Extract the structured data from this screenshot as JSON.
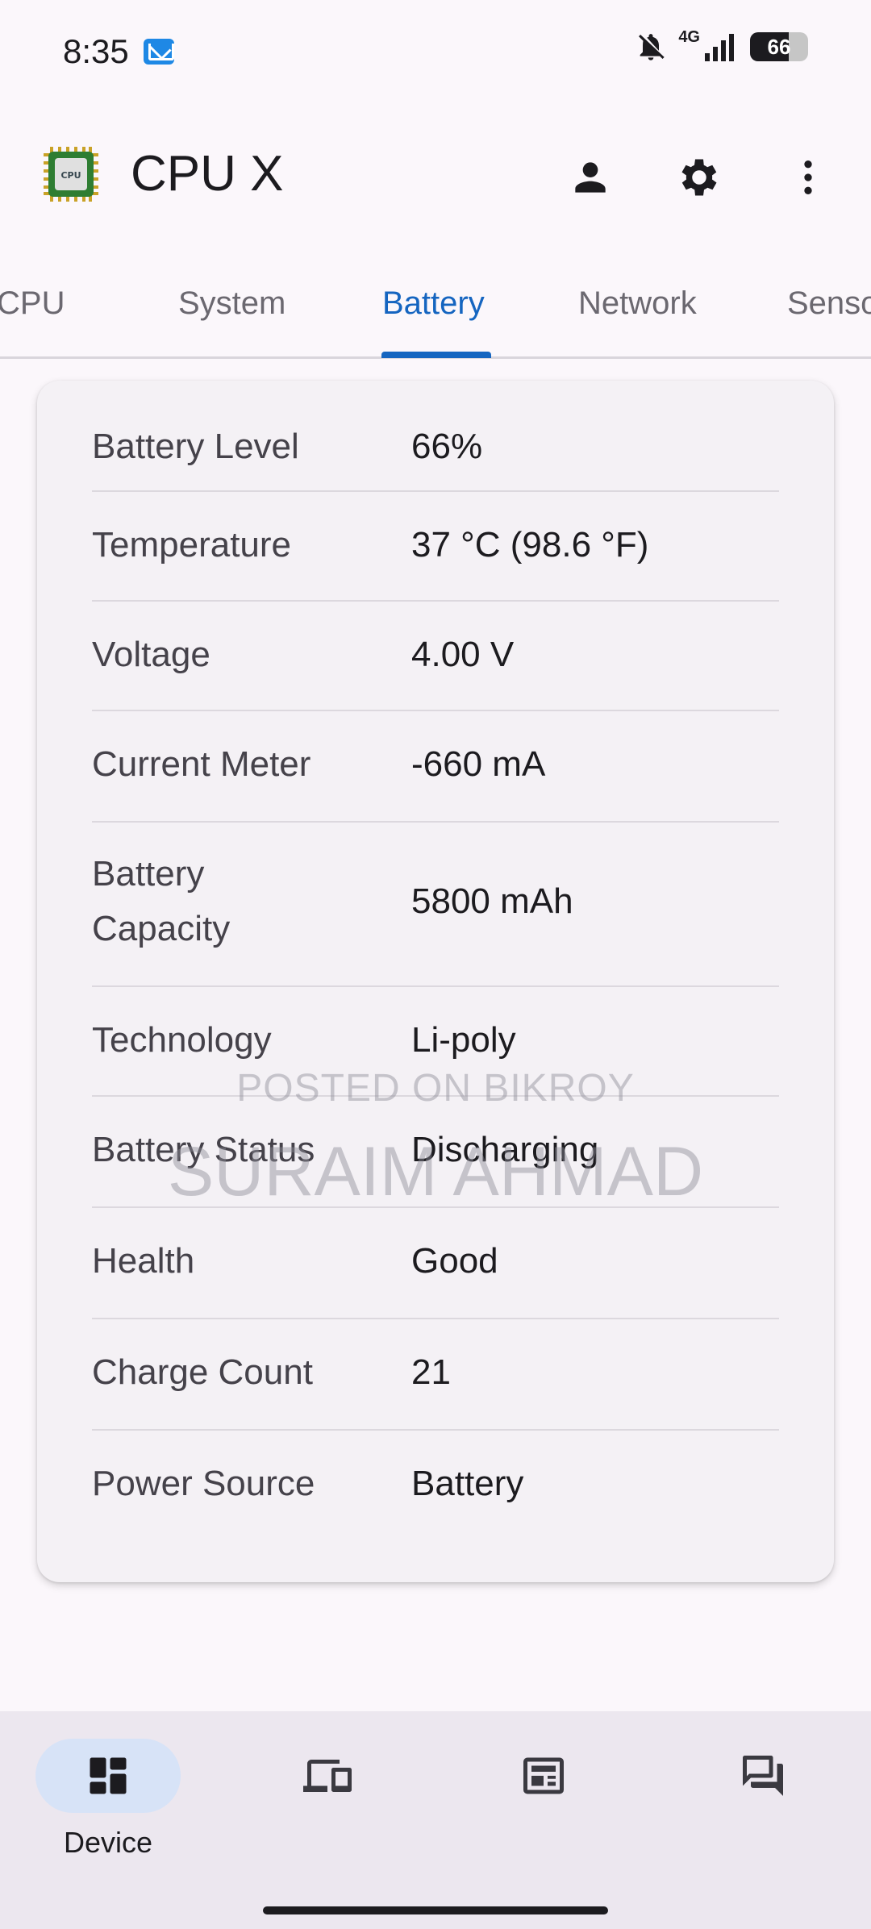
{
  "status_bar": {
    "time": "8:35",
    "network": "4G",
    "battery_level": "66",
    "battery_fraction": 0.66
  },
  "app_bar": {
    "title": "CPU X",
    "logo_text": "CPU",
    "icons": [
      "person-icon",
      "gear-icon",
      "more-vert-icon"
    ]
  },
  "tabs": [
    {
      "label": "CPU",
      "active": false
    },
    {
      "label": "System",
      "active": false
    },
    {
      "label": "Battery",
      "active": true
    },
    {
      "label": "Network",
      "active": false
    },
    {
      "label": "Senso",
      "active": false
    }
  ],
  "battery_info": [
    {
      "label": "Battery Level",
      "value": "66%"
    },
    {
      "label": "Temperature",
      "value": "37 °C (98.6 °F)"
    },
    {
      "label": "Voltage",
      "value": "4.00 V"
    },
    {
      "label": "Current Meter",
      "value": "-660 mA"
    },
    {
      "label": "Battery Capacity",
      "value": "5800 mAh"
    },
    {
      "label": "Technology",
      "value": "Li-poly"
    },
    {
      "label": "Battery Status",
      "value": "Discharging"
    },
    {
      "label": "Health",
      "value": "Good"
    },
    {
      "label": "Charge Count",
      "value": "21"
    },
    {
      "label": "Power Source",
      "value": "Battery"
    }
  ],
  "watermark": {
    "line1": "POSTED ON BIKROY",
    "line2": "SURAIM AHMAD"
  },
  "bottom_nav": [
    {
      "label": "Device",
      "icon": "dashboard-icon",
      "active": true
    },
    {
      "label": "",
      "icon": "devices-icon",
      "active": false
    },
    {
      "label": "",
      "icon": "news-icon",
      "active": false
    },
    {
      "label": "",
      "icon": "forum-icon",
      "active": false
    }
  ],
  "colors": {
    "accent": "#1565c0",
    "background": "#fbf7fb",
    "card": "#f4f1f5",
    "nav_pill": "#d7e3f7"
  }
}
